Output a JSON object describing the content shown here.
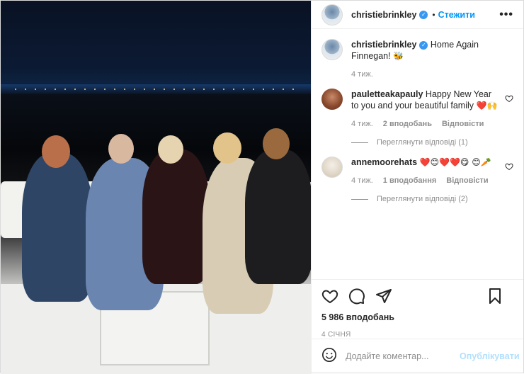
{
  "header": {
    "username": "christiebrinkley",
    "follow_label": "Стежити",
    "more_label": "•••"
  },
  "caption": {
    "username": "christiebrinkley",
    "text": "Home Again Finnegan!",
    "emoji": "🐝",
    "time": "4 тиж."
  },
  "comments": [
    {
      "username": "pauletteakapauly",
      "text": "Happy New Year to you and your beautiful family",
      "emoji": "❤️🙌",
      "time": "4 тиж.",
      "likes": "2 вподобань",
      "reply_label": "Відповісти",
      "view_replies": "Переглянути відповіді (1)"
    },
    {
      "username": "annemoorehats",
      "text": "",
      "emoji": "❤️😊❤️❤️😋 😊🥕",
      "time": "4 тиж.",
      "likes": "1 вподобання",
      "reply_label": "Відповісти",
      "view_replies": "Переглянути відповіді (2)"
    }
  ],
  "actions": {
    "like_icon": "heart-icon",
    "comment_icon": "comment-icon",
    "share_icon": "share-icon",
    "save_icon": "bookmark-icon"
  },
  "likes": "5 986 вподобань",
  "date": "4 січня",
  "add_comment": {
    "placeholder": "Додайте коментар...",
    "publish_label": "Опублікувати"
  },
  "colors": {
    "accent": "#0095f6",
    "publish_disabled": "#b2dffc",
    "verified": "#3897f0",
    "heart_red": "#ed4956"
  }
}
